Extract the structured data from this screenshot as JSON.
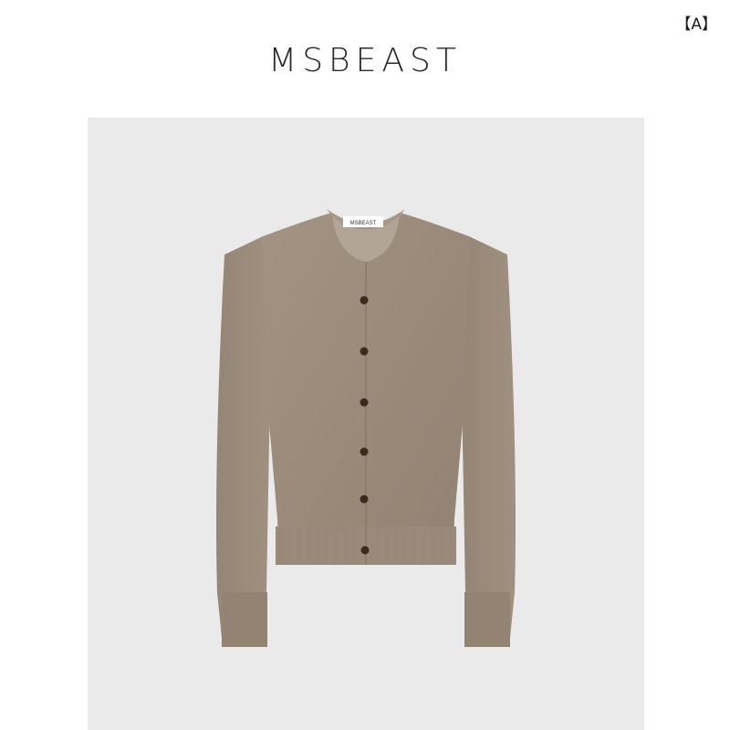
{
  "badge": {
    "text": "【A】"
  },
  "brand": {
    "name": "MSBEAST"
  },
  "product": {
    "neck_label": "MSBEAST",
    "garment_color": "#9c8b7c",
    "background_color": "#eaeaea"
  }
}
